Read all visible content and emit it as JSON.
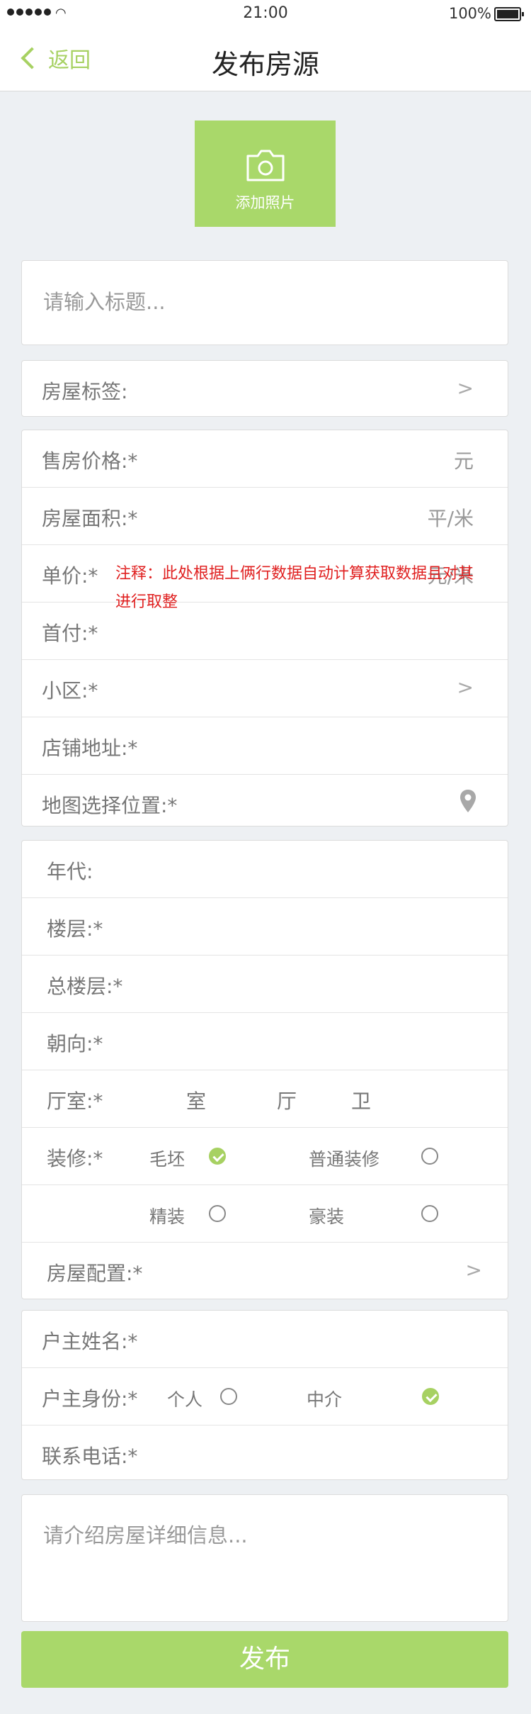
{
  "status": {
    "time": "21:00",
    "battery": "100%"
  },
  "nav": {
    "back": "返回",
    "title": "发布房源"
  },
  "photo": {
    "label": "添加照片"
  },
  "title_placeholder": "请输入标题...",
  "tags": {
    "label": "房屋标签:",
    "arrow": ">"
  },
  "pricing": {
    "price": {
      "label": "售房价格:*",
      "unit": "元"
    },
    "area": {
      "label": "房屋面积:*",
      "unit": "平/米"
    },
    "unit_price": {
      "label": "单价:*",
      "unit": "元/米"
    },
    "down_payment": {
      "label": "首付:*"
    },
    "community": {
      "label": "小区:*",
      "arrow": ">"
    },
    "address": {
      "label": "店铺地址:*"
    },
    "map": {
      "label": "地图选择位置:*"
    }
  },
  "note": "注释：此处根据上俩行数据自动计算获取数据且对其进行取整",
  "details": {
    "year": "年代:",
    "floor": "楼层:*",
    "total_floor": "总楼层:*",
    "orientation": "朝向:*",
    "rooms": {
      "label": "厅室:*",
      "room": "室",
      "hall": "厅",
      "bath": "卫"
    },
    "decoration": {
      "label": "装修:*",
      "options": [
        "毛坯",
        "普通装修",
        "精装",
        "豪装"
      ],
      "selected": "毛坯"
    },
    "config": {
      "label": "房屋配置:*",
      "arrow": ">"
    }
  },
  "owner": {
    "name": "户主姓名:*",
    "identity": {
      "label": "户主身份:*",
      "personal": "个人",
      "agent": "中介",
      "selected": "中介"
    },
    "phone": "联系电话:*"
  },
  "description_placeholder": "请介绍房屋详细信息...",
  "publish": "发布",
  "colors": {
    "accent": "#a9d86a",
    "note": "#e02020",
    "background": "#edf0f3"
  }
}
